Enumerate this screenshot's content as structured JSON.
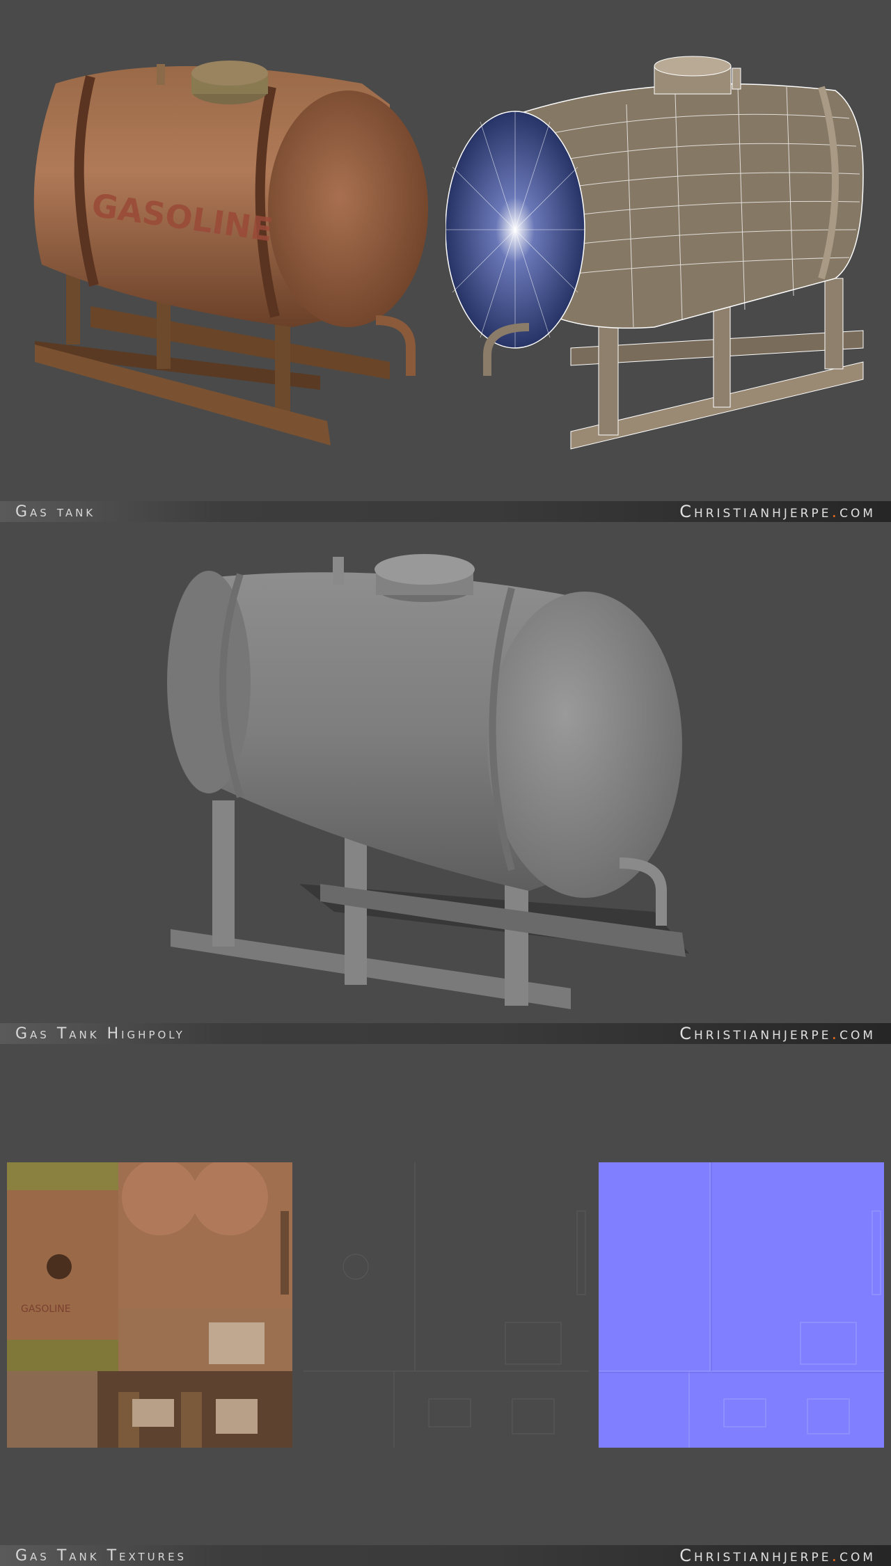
{
  "sections": [
    {
      "title": "Gas tank",
      "site_pre": "Christianhjerpe",
      "site_dot": ".",
      "site_post": "com"
    },
    {
      "title": "Gas Tank Highpoly",
      "site_pre": "Christianhjerpe",
      "site_dot": ".",
      "site_post": "com"
    },
    {
      "title": "Gas Tank Textures",
      "site_pre": "Christianhjerpe",
      "site_dot": ".",
      "site_post": "com"
    }
  ],
  "renders": {
    "textured_label": "GASOLINE",
    "diffuse_label": "GASOLINE"
  },
  "colors": {
    "background": "#4a4a4a",
    "rust": "#8a5a3a",
    "wire_base": "#8a7c68",
    "clay": "#8a8a8a",
    "normal_map": "#7f7fff",
    "accent_dot": "#e06a1a"
  }
}
